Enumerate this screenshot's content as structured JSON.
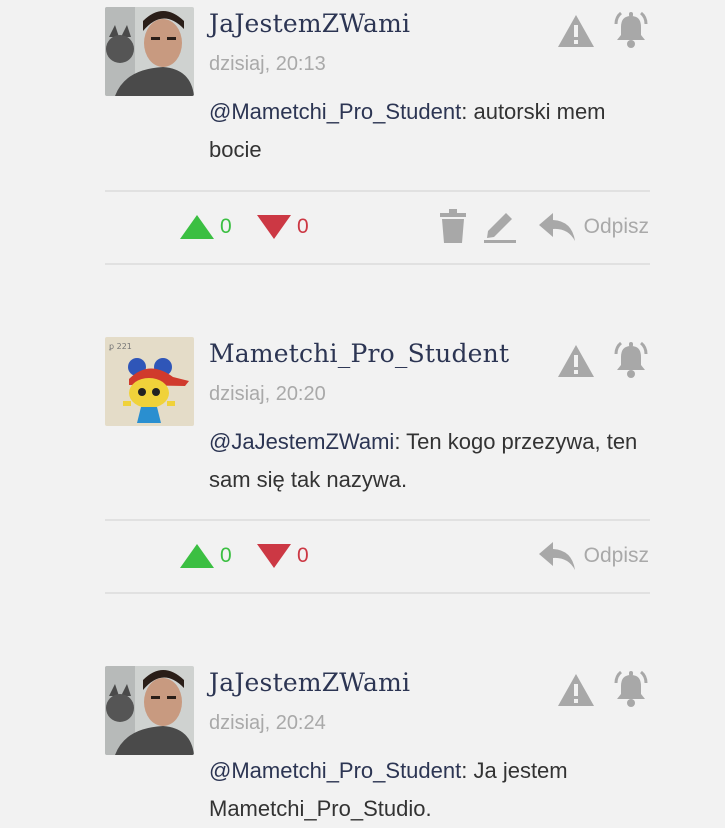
{
  "colors": {
    "background": "#f2f2f2",
    "author": "#2c3553",
    "muted": "#a9a9a9",
    "upvote": "#3bbf42",
    "downvote": "#cc3844",
    "icon": "#a8a8a8"
  },
  "comments": [
    {
      "author": "JaJestemZWami",
      "time": "dzisiaj, 20:13",
      "mention": "@Mametchi_Pro_Student",
      "text": ": autorski mem bocie",
      "upvotes": "0",
      "downvotes": "0",
      "reply_label": "Odpisz",
      "icons": [
        "warning-icon",
        "bell-icon",
        "trash-icon",
        "pencil-icon",
        "reply-arrow-icon"
      ]
    },
    {
      "author": "Mametchi_Pro_Student",
      "time": "dzisiaj, 20:20",
      "mention": "@JaJestemZWami",
      "text": ": Ten kogo przezywa, ten sam się tak nazywa.",
      "upvotes": "0",
      "downvotes": "0",
      "reply_label": "Odpisz",
      "icons": [
        "warning-icon",
        "bell-icon",
        "reply-arrow-icon"
      ]
    },
    {
      "author": "JaJestemZWami",
      "time": "dzisiaj, 20:24",
      "mention": "@Mametchi_Pro_Student",
      "text": ": Ja jestem Mametchi_Pro_Studio.",
      "icons": [
        "warning-icon",
        "bell-icon"
      ]
    }
  ]
}
